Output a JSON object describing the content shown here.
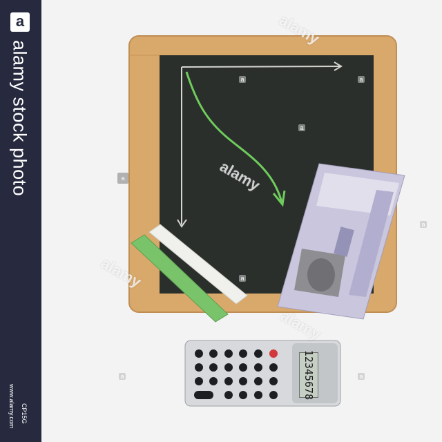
{
  "sidebar": {
    "logo_glyph": "a",
    "brand": "alamy stock photo",
    "website": "www.alamy.com",
    "image_code": "CP15G"
  },
  "watermark": {
    "text": "alamy",
    "badge_glyph": "a"
  },
  "calculator": {
    "display_value": "12345678"
  },
  "colors": {
    "sidebar_bg": "#272a3f",
    "page_bg": "#f3f3f3",
    "board": "#2a2f2b",
    "frame": "#d9a86b",
    "chalk_green": "#6fbf5e"
  }
}
